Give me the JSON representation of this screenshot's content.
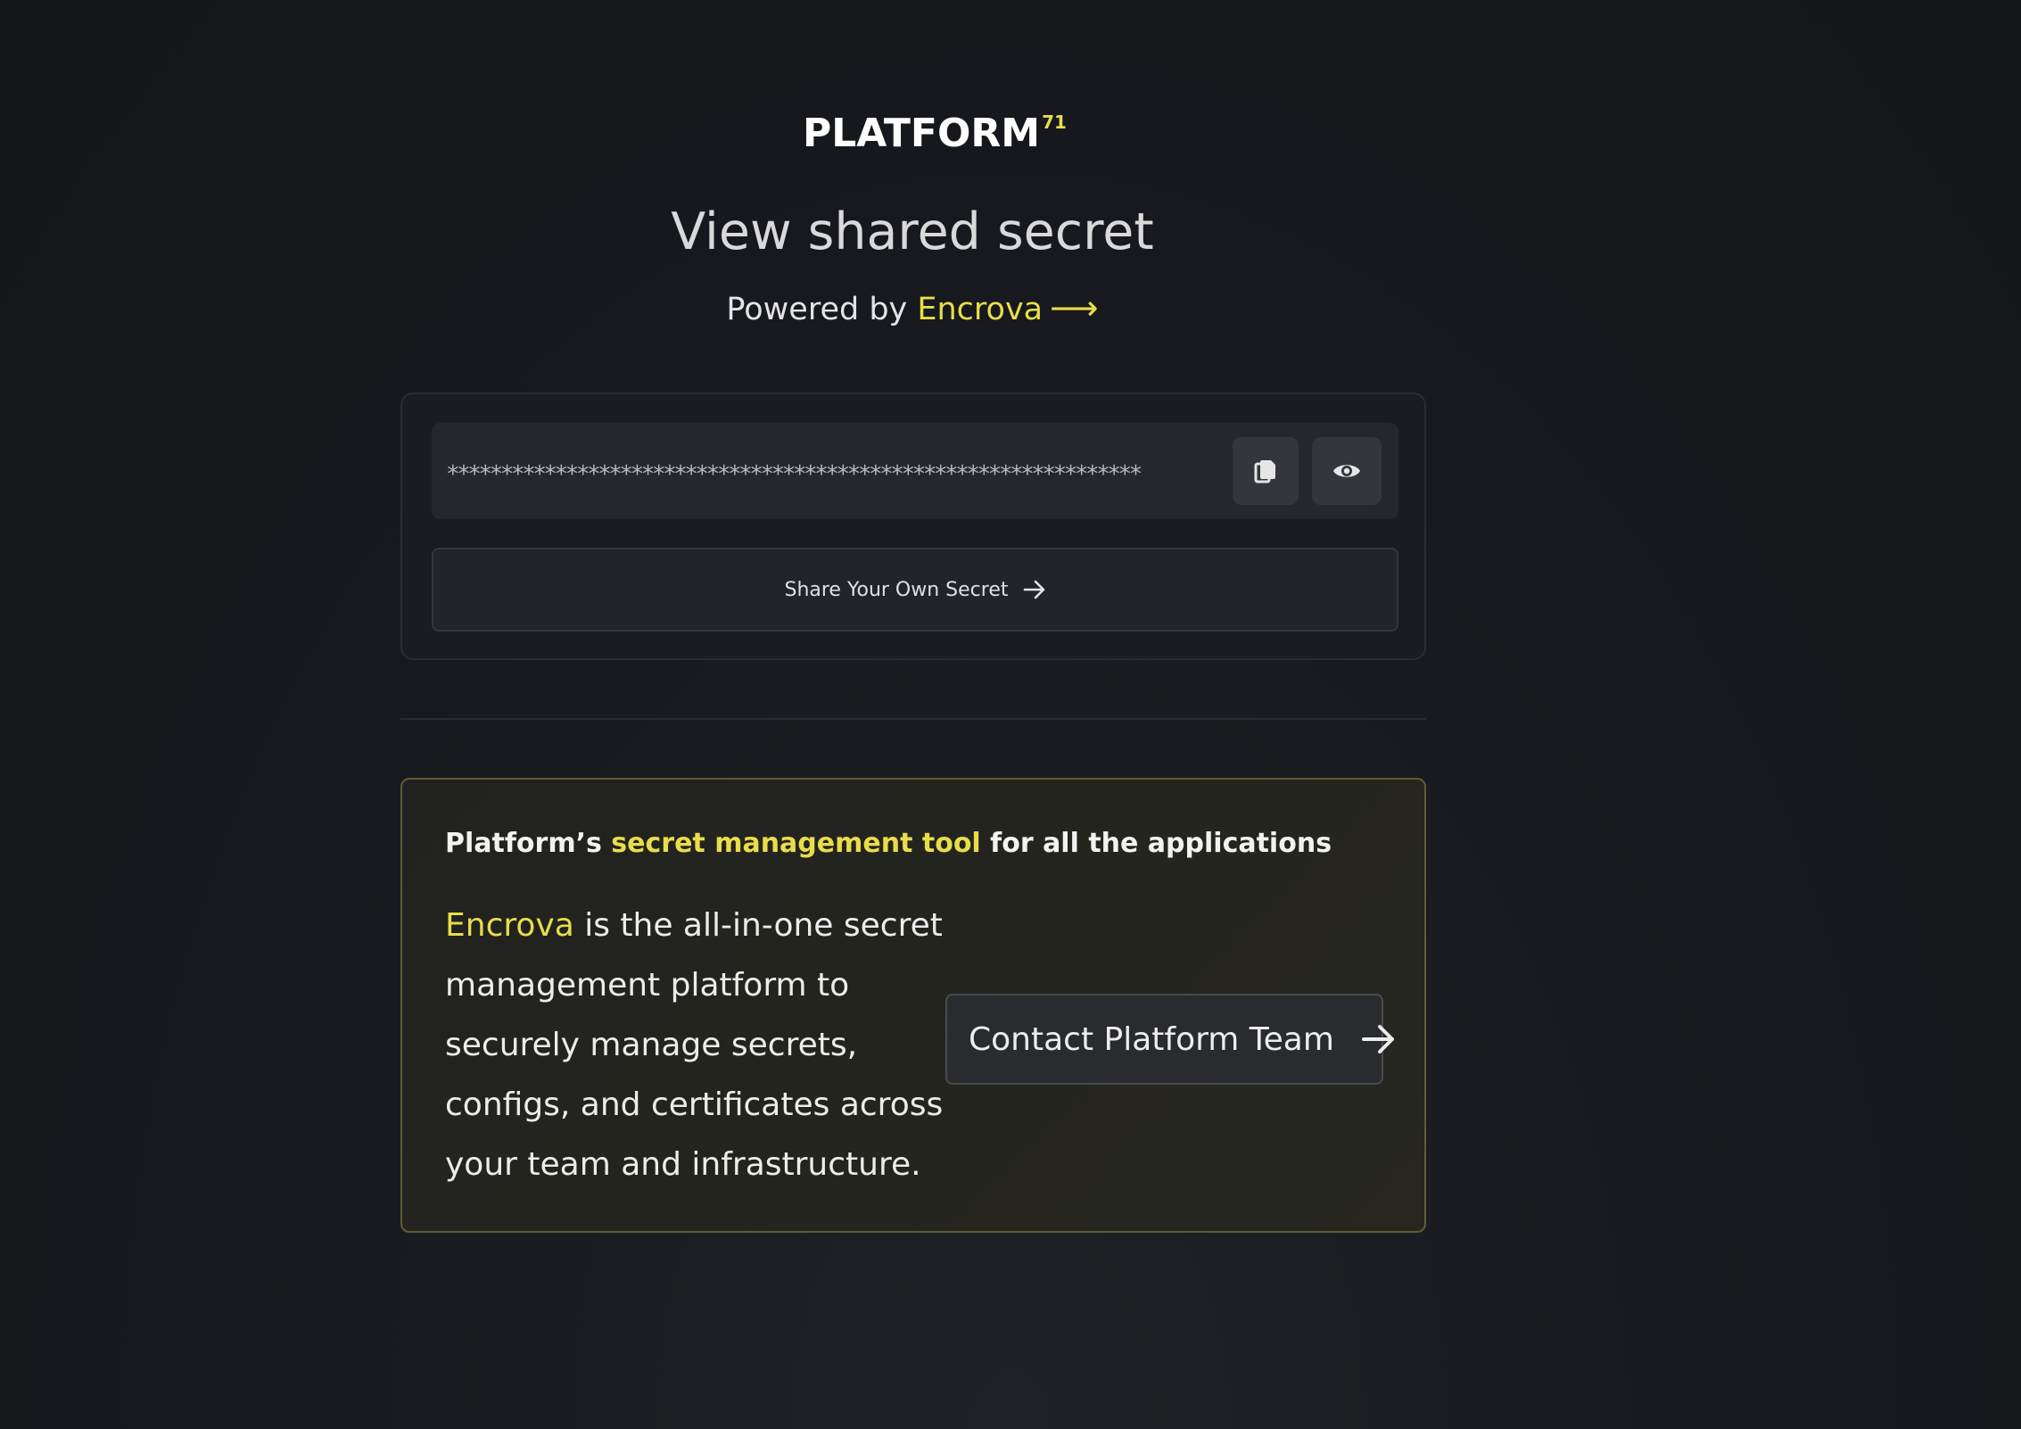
{
  "logo": {
    "text": "PLATFORM",
    "superscript": "71"
  },
  "page": {
    "title": "View shared secret",
    "powered_prefix": "Powered by ",
    "powered_brand": "Encrova",
    "powered_arrow": "⟶"
  },
  "secret": {
    "masked_value": "****************************************************************",
    "copy_icon": "copy-icon",
    "reveal_icon": "eye-icon"
  },
  "share_button": {
    "label": "Share Your Own Secret",
    "icon": "arrow-right-icon"
  },
  "promo": {
    "heading_prefix": "Platform’s ",
    "heading_highlight": "secret management tool",
    "heading_suffix": " for all the applications",
    "body_brand": "Encrova",
    "body_text": " is the all-in-one secret management platform to securely manage secrets, configs, and certificates across your team and infrastructure.",
    "contact_label": "Contact Platform Team",
    "contact_icon": "arrow-right-icon"
  },
  "colors": {
    "accent": "#e8dd4a",
    "background": "#16181d",
    "promo_border": "#5f5c33"
  }
}
